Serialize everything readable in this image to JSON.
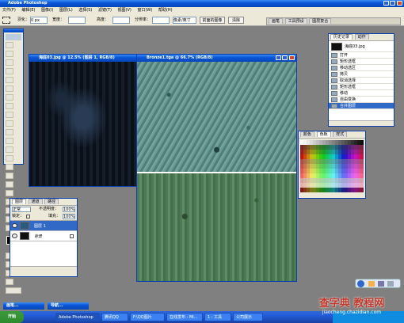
{
  "app": {
    "title": "Adobe Photoshop"
  },
  "menu": [
    "文件(F)",
    "编辑(E)",
    "图像(I)",
    "图层(L)",
    "选择(S)",
    "滤镜(T)",
    "视图(V)",
    "窗口(W)",
    "帮助(H)"
  ],
  "options": {
    "feather_label": "羽化：",
    "feather_value": "0 px",
    "style_label": "样式：",
    "width_label": "宽度：",
    "height_label": "高度：",
    "resolution_label": "分辨率：",
    "units": "像素/英寸",
    "front_image_button": "前面的图像",
    "clear_button": "清除"
  },
  "palette_well": {
    "tabs": [
      "画笔",
      "工具预设",
      "图层复合"
    ]
  },
  "doc1": {
    "title": "海底03.jpg @ 12.5% (图层 1, RGB/8)"
  },
  "doc2": {
    "title": "Bronze1.tga @ 66.7% (RGB/8)"
  },
  "history": {
    "tabs": [
      "历史记录",
      "动作"
    ],
    "snapshot": "海底03.jpg",
    "items": [
      "打开",
      "矩形选框",
      "移动选区",
      "拷贝",
      "取消选择",
      "矩形选框",
      "移动",
      "自由变换",
      "合并图层"
    ],
    "selected_index": 8
  },
  "swatches": {
    "tabs": [
      "颜色",
      "色板",
      "样式"
    ]
  },
  "layers": {
    "tabs": [
      "图层",
      "通道",
      "路径"
    ],
    "blend_mode": "正常",
    "opacity_label": "不透明度：",
    "opacity": "100%",
    "lock_label": "锁定：",
    "fill_label": "填充：",
    "fill": "100%",
    "rows": [
      {
        "name": "图层 1",
        "selected": true
      },
      {
        "name": "背景",
        "selected": false
      }
    ]
  },
  "minimized": [
    "画笔...",
    "导航..."
  ],
  "taskbar": {
    "start": "开始",
    "items": [
      "Adobe Photoshop",
      "腾讯QQ",
      "F:\\QQ图片",
      "在线发布 - Mi...",
      "1 - 工具",
      "公司展示"
    ],
    "watermark": "查字典 教程网",
    "watermark_url": "jiaocheng.chazidian.com"
  }
}
